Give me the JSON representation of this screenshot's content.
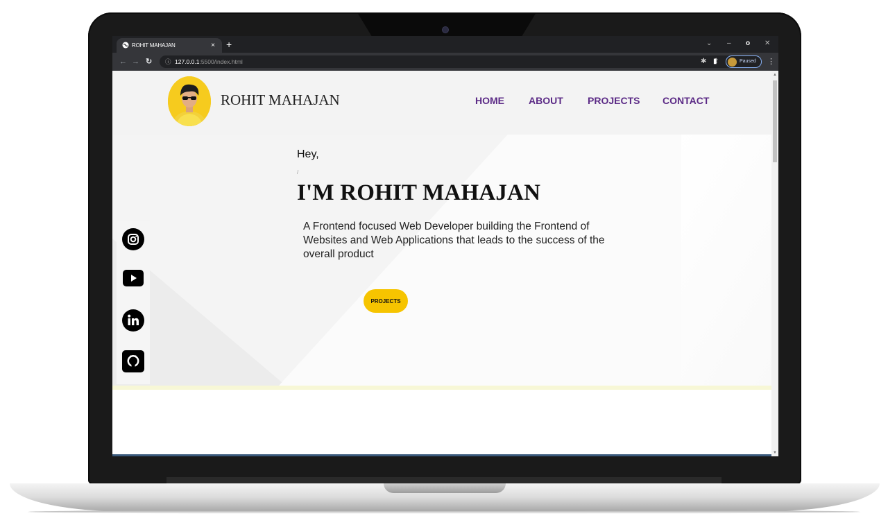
{
  "browser": {
    "tab_title": "ROHIT MAHAJAN",
    "tab_close": "×",
    "new_tab": "+",
    "url_host": "127.0.0.1",
    "url_rest": ":5500/index.html",
    "profile_status": "Paused",
    "window_controls": {
      "minimize": "–",
      "maximize": "o",
      "close": "✕",
      "dropdown": "⌄"
    }
  },
  "site": {
    "brand": "ROHIT MAHAJAN",
    "nav": [
      "HOME",
      "ABOUT",
      "PROJECTS",
      "CONTACT"
    ],
    "hero": {
      "greeting": "Hey,",
      "cursor": "/",
      "title": "I'M ROHIT MAHAJAN",
      "description": "A Frontend focused Web Developer building the Frontend of Websites and Web Applications that leads to the success of the overall product",
      "cta_label": "PROJECTS"
    },
    "social": [
      "instagram-icon",
      "youtube-icon",
      "linkedin-icon",
      "github-icon"
    ]
  },
  "colors": {
    "nav_link": "#5b2a86",
    "accent_yellow": "#f6c400",
    "header_bg": "#f3f3f3"
  }
}
